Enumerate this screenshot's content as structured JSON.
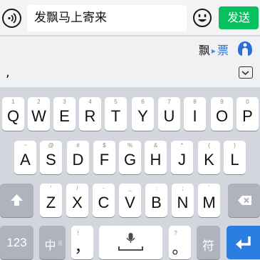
{
  "chat": {
    "input_value": "发飘马上寄来",
    "send_label": "发送",
    "voice_icon": "voice-icon",
    "emoji_icon": "emoji-icon"
  },
  "candidates": {
    "word_a": "飘",
    "word_b": "票",
    "logo_icon": "sogou-logo-icon"
  },
  "composition": {
    "text": ",",
    "collapse_icon": "keyboard-collapse-icon"
  },
  "keyboard": {
    "row1": [
      {
        "main": "Q",
        "sub": "1"
      },
      {
        "main": "W",
        "sub": "2"
      },
      {
        "main": "E",
        "sub": "3"
      },
      {
        "main": "R",
        "sub": "4"
      },
      {
        "main": "T",
        "sub": "5"
      },
      {
        "main": "Y",
        "sub": "6"
      },
      {
        "main": "U",
        "sub": "7"
      },
      {
        "main": "I",
        "sub": "8"
      },
      {
        "main": "O",
        "sub": "9"
      },
      {
        "main": "P",
        "sub": "0"
      }
    ],
    "row2": [
      {
        "main": "A",
        "sub": "~"
      },
      {
        "main": "S",
        "sub": "@"
      },
      {
        "main": "D",
        "sub": "#"
      },
      {
        "main": "F",
        "sub": "$"
      },
      {
        "main": "G",
        "sub": "%"
      },
      {
        "main": "H",
        "sub": "&"
      },
      {
        "main": "J",
        "sub": "*"
      },
      {
        "main": "K",
        "sub": "("
      },
      {
        "main": "L",
        "sub": ")"
      }
    ],
    "row3": [
      {
        "main": "Z",
        "sub": "'"
      },
      {
        "main": "X",
        "sub": "/"
      },
      {
        "main": "C",
        "sub": "-"
      },
      {
        "main": "V",
        "sub": "_"
      },
      {
        "main": "B",
        "sub": ":"
      },
      {
        "main": "N",
        "sub": ";"
      },
      {
        "main": "M",
        "sub": "`"
      }
    ],
    "num_label": "123",
    "zh_label": "中",
    "zh_sub": "英",
    "comma_label": "，",
    "comma_sub": "!",
    "period_label": "。",
    "period_sub": "?",
    "symbol_label": "符",
    "shift_icon": "shift-icon",
    "delete_icon": "delete-icon",
    "mic_icon": "microphone-icon",
    "space_icon": "space-icon",
    "enter_icon": "enter-icon"
  }
}
